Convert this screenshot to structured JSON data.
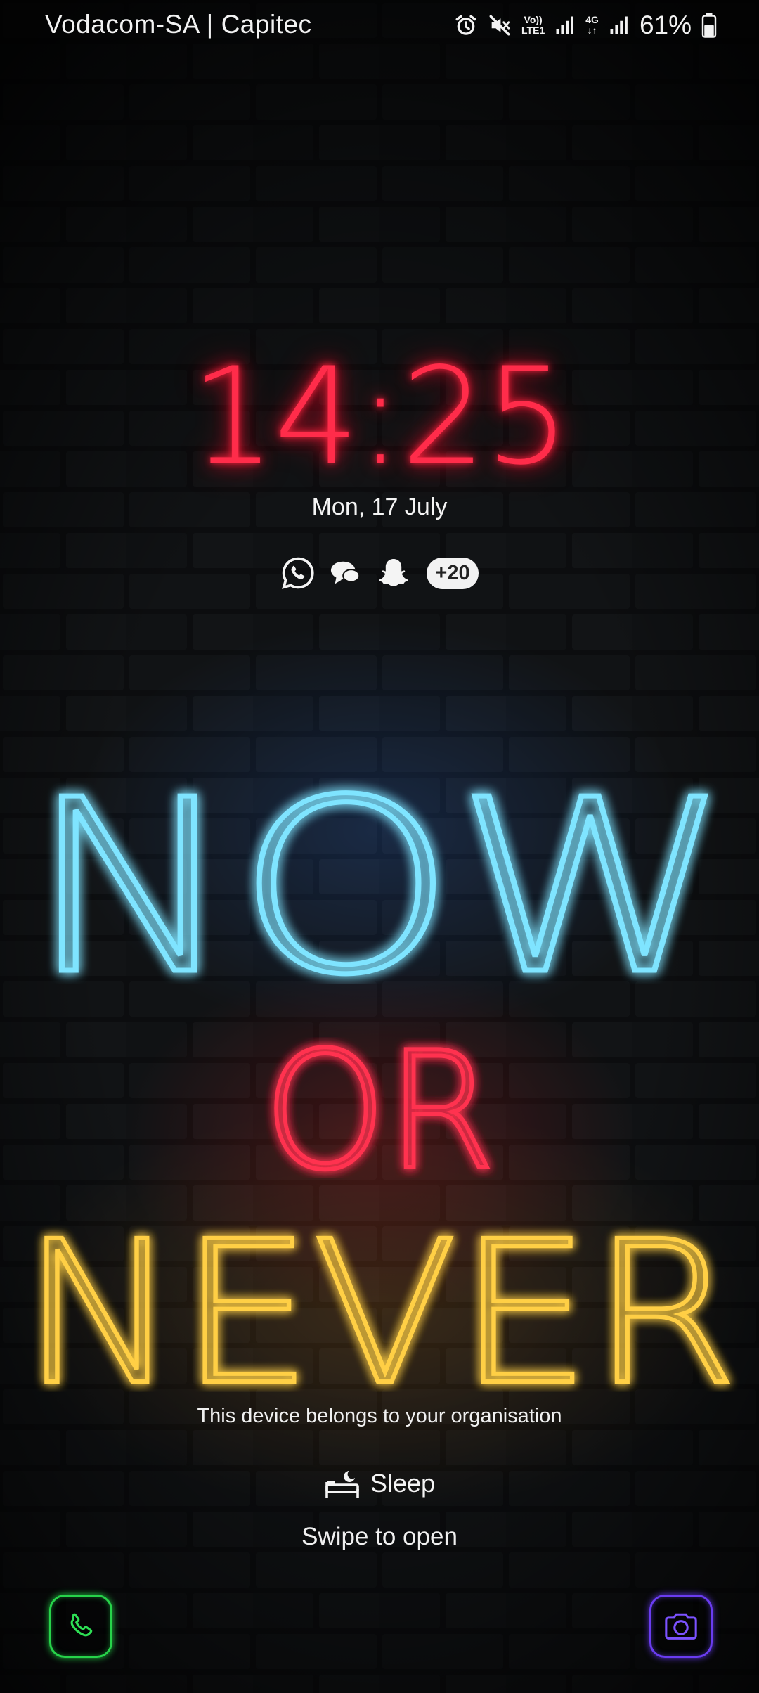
{
  "status_bar": {
    "carrier": "Vodacom-SA | Capitec",
    "volte_label_top": "Vo))",
    "volte_label_bottom": "LTE1",
    "network_label": "4G",
    "battery_percent": "61%",
    "battery_level": 0.61,
    "icons": [
      "alarm-icon",
      "mute-icon",
      "volte-icon",
      "signal-icon",
      "4g-data-icon",
      "signal-icon",
      "battery-icon"
    ]
  },
  "lockscreen": {
    "time": "14:25",
    "date": "Mon, 17 July",
    "notification_icons": [
      "whatsapp-icon",
      "messages-icon",
      "snapchat-icon"
    ],
    "more_notifications": "+20",
    "org_notice": "This device belongs to your organisation",
    "sleep_label": "Sleep",
    "swipe_hint": "Swipe to open"
  },
  "wallpaper": {
    "line1": "NOW",
    "line2": "OR",
    "line3": "NEVER",
    "colors": {
      "now": "#5fd6ff",
      "or": "#ff2a45",
      "never": "#ffc43a"
    }
  },
  "shortcuts": {
    "left": "phone-icon",
    "right": "camera-icon",
    "left_color": "#27d34a",
    "right_color": "#6a3cf0"
  },
  "colors": {
    "clock": "#ff2c4a",
    "text": "#f4f4f4"
  }
}
